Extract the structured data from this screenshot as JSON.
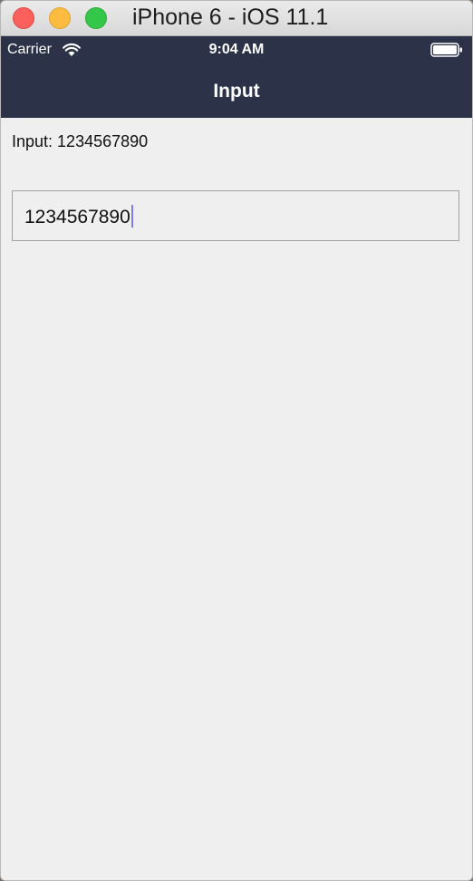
{
  "window": {
    "title": "iPhone 6 - iOS 11.1"
  },
  "status_bar": {
    "carrier": "Carrier",
    "time": "9:04 AM",
    "icons": [
      "wifi-icon",
      "battery-icon"
    ]
  },
  "nav_bar": {
    "title": "Input"
  },
  "content": {
    "label_prefix": "Input: ",
    "label_value": "1234567890",
    "text_field": {
      "value": "1234567890"
    }
  },
  "colors": {
    "nav_background": "#2c3349",
    "content_background": "#efeff0",
    "caret": "#7d7ff0"
  }
}
